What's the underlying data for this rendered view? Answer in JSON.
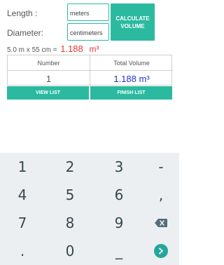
{
  "form": {
    "length_label": "Length :",
    "length_value": "meters",
    "diameter_label": "Diameter:",
    "diameter_value": "centimeters",
    "calculate_label_line1": "CALCULATE",
    "calculate_label_line2": "VOLUME"
  },
  "result": {
    "formula_text": "5.0 m x 55 cm =",
    "volume_value": "1.188",
    "volume_unit": "m³"
  },
  "table": {
    "headers": [
      "Number",
      "Total Volume"
    ],
    "number_value": "1",
    "total_volume_value": "1.188  m³"
  },
  "actions": {
    "view_list": "VIEW LIST",
    "finish_list": "FINISH LIST"
  },
  "keyboard": {
    "rows": [
      [
        "1",
        "2",
        "3",
        "-"
      ],
      [
        "4",
        "5",
        "6",
        ","
      ],
      [
        "7",
        "8",
        "9",
        "backspace"
      ],
      [
        ".",
        "0",
        "_",
        "go"
      ]
    ]
  },
  "colors": {
    "accent": "#2bbaa0",
    "result_red": "#e53935",
    "volume_blue": "#2233cc",
    "keyboard_bg": "#eceff1"
  }
}
